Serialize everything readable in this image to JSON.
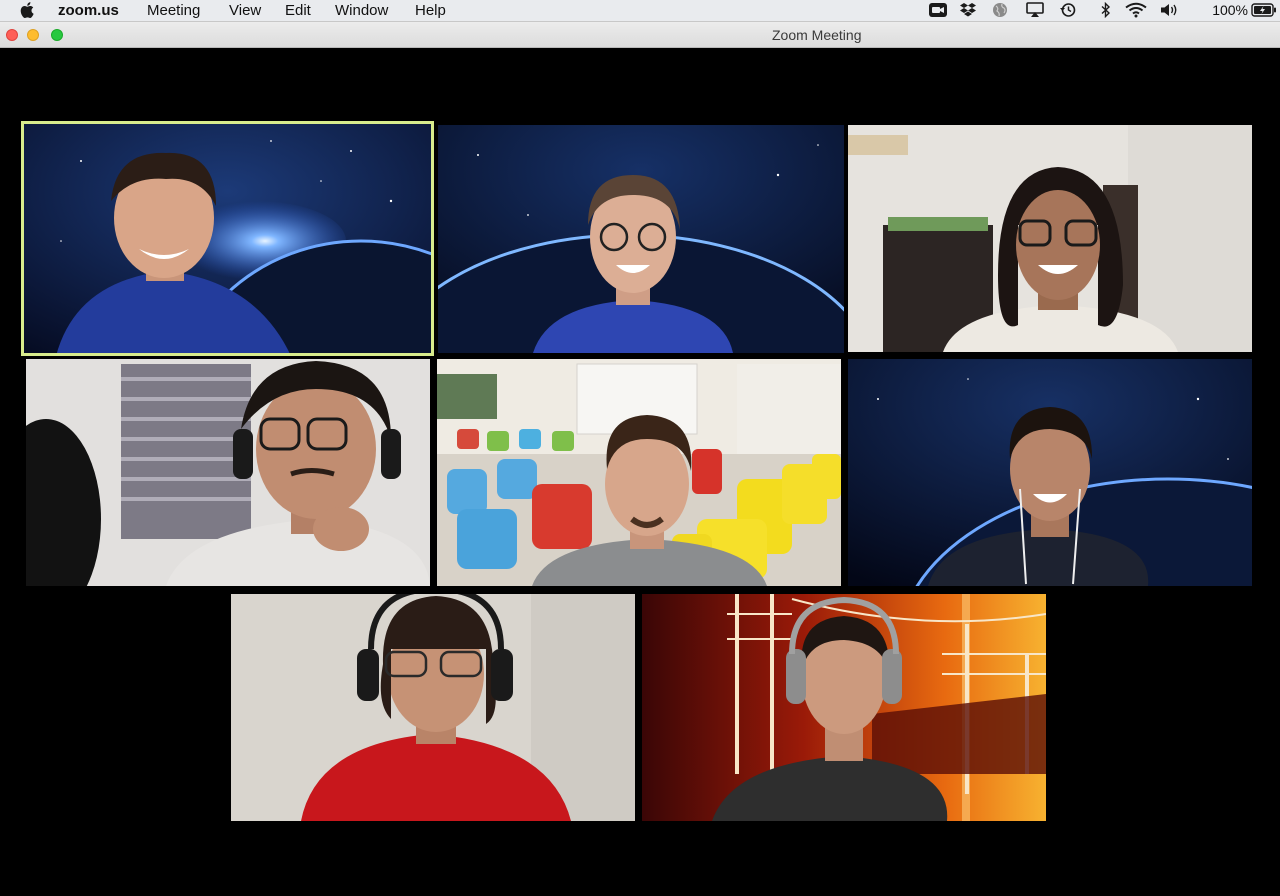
{
  "menubar": {
    "app_name": "zoom.us",
    "items": [
      "Meeting",
      "View",
      "Edit",
      "Window",
      "Help"
    ],
    "battery": "100%"
  },
  "window": {
    "title": "Zoom Meeting"
  },
  "participants": [
    {
      "tile": 1,
      "background": "earth-space",
      "active_speaker": true
    },
    {
      "tile": 2,
      "background": "earth-space",
      "active_speaker": false
    },
    {
      "tile": 3,
      "background": "room-wall",
      "active_speaker": false
    },
    {
      "tile": 4,
      "background": "room-window",
      "active_speaker": false
    },
    {
      "tile": 5,
      "background": "classroom",
      "active_speaker": false
    },
    {
      "tile": 6,
      "background": "earth-space",
      "active_speaker": false
    },
    {
      "tile": 7,
      "background": "plain-wall",
      "active_speaker": false
    },
    {
      "tile": 8,
      "background": "sunset-railway",
      "active_speaker": false
    }
  ],
  "colors": {
    "active_speaker_border": "#d8ec8c",
    "grid_background": "#000000"
  }
}
